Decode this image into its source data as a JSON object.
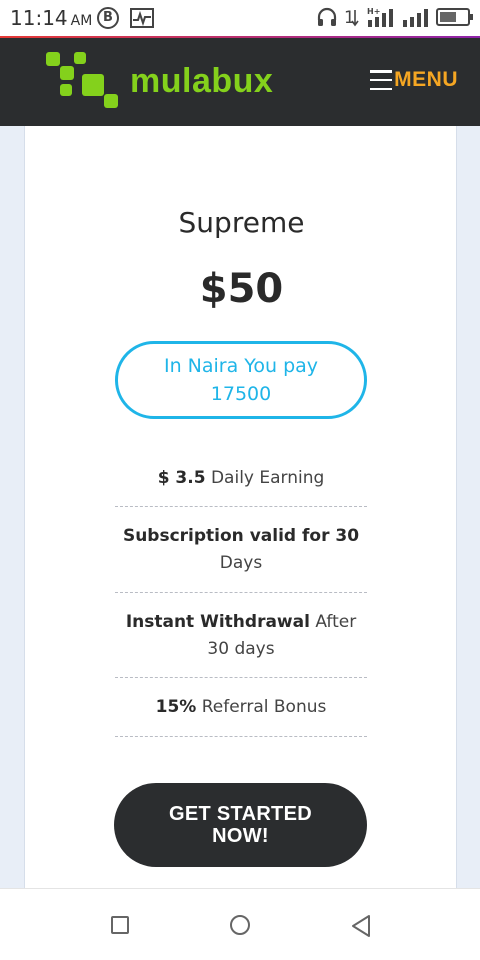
{
  "status_bar": {
    "time": "11:14",
    "ampm": "AM",
    "bitcoin_glyph": "B",
    "signal_label": "H+",
    "icons": [
      "bitcoin-icon",
      "pulse-icon",
      "headphones-icon",
      "data-arrows-icon",
      "signal-icon",
      "battery-icon"
    ],
    "battery_level": 0.6
  },
  "header": {
    "brand": "mulabux",
    "menu_label": "MENU",
    "brand_color": "#84d11c",
    "menu_color": "#f5a623",
    "background": "#2b2d2f"
  },
  "plan": {
    "name": "Supreme",
    "price": "$50",
    "naira_line1": "In Naira You pay",
    "naira_amount": "17500",
    "accent": "#1fb5e8"
  },
  "features": [
    {
      "bold": "$ 3.5",
      "text": " Daily Earning"
    },
    {
      "bold": "Subscription valid for 30",
      "text": " Days"
    },
    {
      "bold": "Instant Withdrawal",
      "text": " After 30 days"
    },
    {
      "bold": "15%",
      "text": " Referral Bonus"
    }
  ],
  "cta": {
    "line1": "GET STARTED",
    "line2": "NOW!"
  },
  "nav_bar": {
    "icons": [
      "recent-apps-icon",
      "home-icon",
      "back-icon"
    ]
  }
}
